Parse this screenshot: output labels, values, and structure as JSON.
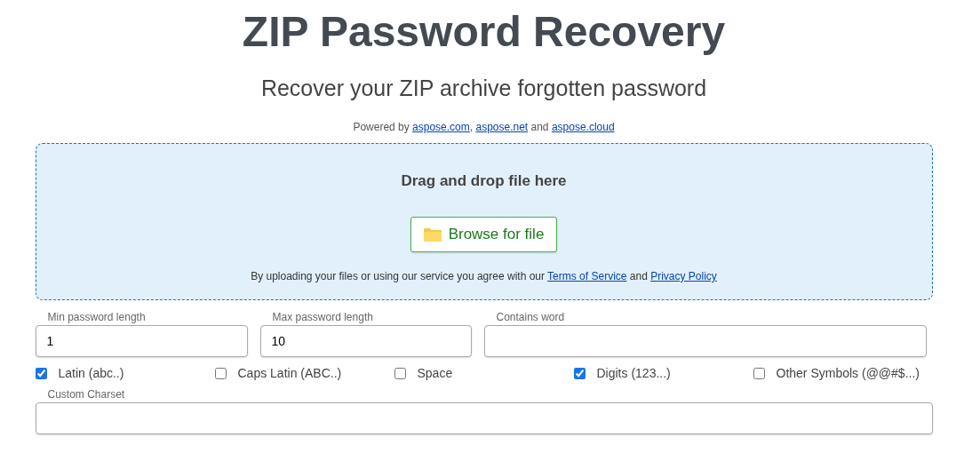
{
  "title": "ZIP Password Recovery",
  "subtitle": "Recover your ZIP archive forgotten password",
  "powered": [
    {
      "kind": "text",
      "text": "Powered by "
    },
    {
      "kind": "link",
      "text": "aspose.com"
    },
    {
      "kind": "text",
      "text": ", "
    },
    {
      "kind": "link",
      "text": "aspose.net"
    },
    {
      "kind": "text",
      "text": " and "
    },
    {
      "kind": "link",
      "text": "aspose.cloud"
    }
  ],
  "dropzone": {
    "heading": "Drag and drop file here",
    "button": "Browse for file",
    "terms": [
      {
        "kind": "text",
        "text": "By uploading your files or using our service you agree with our "
      },
      {
        "kind": "link",
        "text": "Terms of Service"
      },
      {
        "kind": "text",
        "text": " and "
      },
      {
        "kind": "link",
        "text": "Privacy Policy"
      }
    ]
  },
  "fields": [
    {
      "label": "Min password length",
      "value": "1"
    },
    {
      "label": "Max password length",
      "value": "10"
    },
    {
      "label": "Contains word"
    }
  ],
  "charsets": [
    {
      "label": "Latin (abc..)",
      "checked": true
    },
    {
      "label": "Caps Latin (ABC..)",
      "checked": false
    },
    {
      "label": "Space",
      "checked": false
    },
    {
      "label": "Digits (123...)",
      "checked": true
    },
    {
      "label": "Other Symbols (@@#$...)",
      "checked": false
    }
  ],
  "custom_charset": {
    "label": "Custom Charset"
  }
}
